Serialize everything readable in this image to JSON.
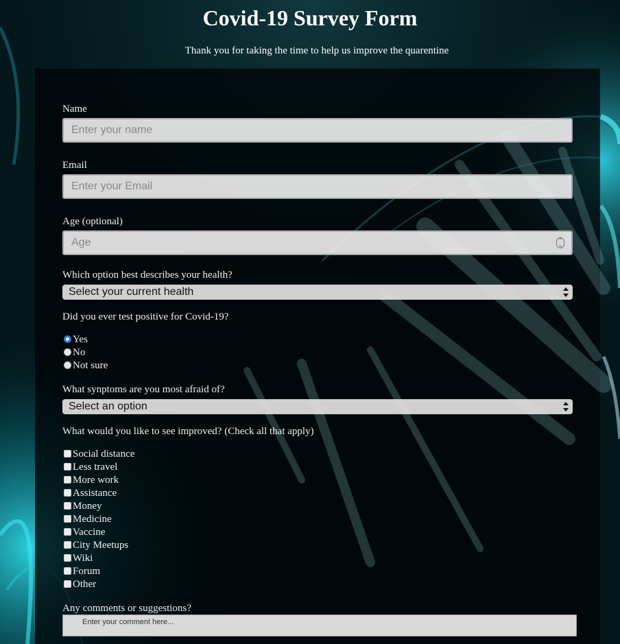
{
  "page": {
    "title": "Covid-19 Survey Form",
    "description": "Thank you for taking the time to help us improve the quarentine"
  },
  "form": {
    "name": {
      "label": "Name",
      "placeholder": "Enter your name"
    },
    "email": {
      "label": "Email",
      "placeholder": "Enter your Email"
    },
    "age": {
      "label": "Age (optional)",
      "placeholder": "Age"
    },
    "health": {
      "label": "Which option best describes your health?",
      "selected": "Select your current health"
    },
    "tested": {
      "label": "Did you ever test positive for Covid-19?",
      "options": [
        {
          "label": "Yes",
          "checked": true
        },
        {
          "label": "No",
          "checked": false
        },
        {
          "label": "Not sure",
          "checked": false
        }
      ]
    },
    "symptoms": {
      "label": "What synptoms are you most afraid of?",
      "selected": "Select an option"
    },
    "improve": {
      "label": "What would you like to see improved? (Check all that apply)",
      "options": [
        {
          "label": "Social distance",
          "checked": false
        },
        {
          "label": "Less travel",
          "checked": false
        },
        {
          "label": "More work",
          "checked": false
        },
        {
          "label": "Assistance",
          "checked": false
        },
        {
          "label": "Money",
          "checked": false
        },
        {
          "label": "Medicine",
          "checked": false
        },
        {
          "label": "Vaccine",
          "checked": false
        },
        {
          "label": "City Meetups",
          "checked": false
        },
        {
          "label": "Wiki",
          "checked": false
        },
        {
          "label": "Forum",
          "checked": false
        },
        {
          "label": "Other",
          "checked": false
        }
      ]
    },
    "comments": {
      "label": "Any comments or suggestions?",
      "placeholder": "Enter your comment here..."
    }
  },
  "colors": {
    "background": "#04181c",
    "panel": "#000508",
    "accent_cyan": "#1fd6e8",
    "radio_checked": "#2a7bd9"
  }
}
